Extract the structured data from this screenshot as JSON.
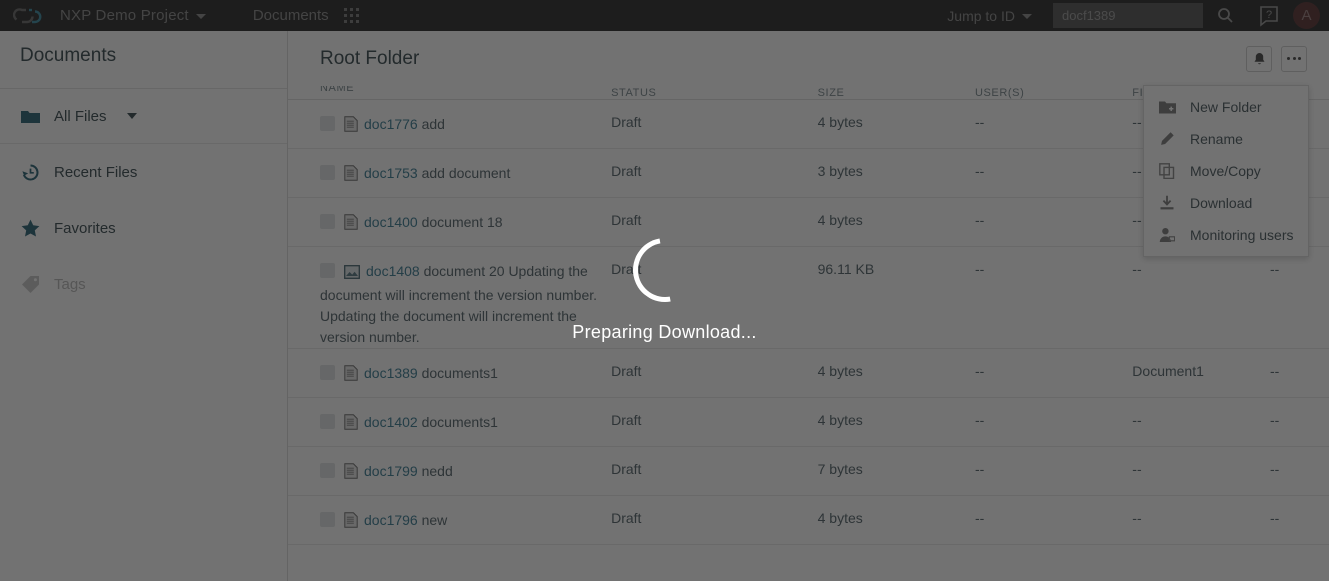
{
  "topbar": {
    "logo_icon": "chain-link-logo-icon",
    "project_name": "NXP Demo Project",
    "project_caret_icon": "chevron-down-icon",
    "nav_documents": "Documents",
    "apps_grid_icon": "apps-grid-icon",
    "jump_to_id_label": "Jump to ID",
    "jump_caret_icon": "chevron-down-icon",
    "search_value": "docf1389",
    "search_placeholder": "",
    "search_icon": "search-icon",
    "help_icon": "help-question-icon",
    "avatar_letter": "A"
  },
  "sidebar": {
    "title": "Documents",
    "items": [
      {
        "label": "All Files",
        "icon": "folder-icon",
        "has_caret": true,
        "dim": false
      },
      {
        "label": "Recent Files",
        "icon": "history-clock-icon",
        "has_caret": false,
        "dim": false
      },
      {
        "label": "Favorites",
        "icon": "star-icon",
        "has_caret": false,
        "dim": false
      },
      {
        "label": "Tags",
        "icon": "tag-icon",
        "has_caret": false,
        "dim": true
      }
    ]
  },
  "content": {
    "folder_title": "Root Folder",
    "bell_icon": "bell-notification-icon",
    "more_icon": "ellipsis-more-icon",
    "columns": [
      "NAME",
      "STATUS",
      "SIZE",
      "USER(S)",
      "FILE CLASS",
      ""
    ],
    "rows": [
      {
        "doc_id": "doc1776",
        "name": " add",
        "icon": "document-file-icon",
        "status": "Draft",
        "size": "4 bytes",
        "users": "--",
        "file_class": "--",
        "last": "--"
      },
      {
        "doc_id": "doc1753",
        "name": " add document",
        "icon": "document-file-icon",
        "status": "Draft",
        "size": "3 bytes",
        "users": "--",
        "file_class": "--",
        "last": "--"
      },
      {
        "doc_id": "doc1400",
        "name": " document 18",
        "icon": "document-file-icon",
        "status": "Draft",
        "size": "4 bytes",
        "users": "--",
        "file_class": "--",
        "last": "--"
      },
      {
        "doc_id": "doc1408",
        "name": " document 20 Updating the document will increment the version number. Updating the document will increment the version number.",
        "icon": "image-file-icon",
        "status": "Draft",
        "size": "96.11 KB",
        "users": "--",
        "file_class": "--",
        "last": "--"
      },
      {
        "doc_id": "doc1389",
        "name": " documents1",
        "icon": "document-file-icon",
        "status": "Draft",
        "size": "4 bytes",
        "users": "--",
        "file_class": "Document1",
        "last": "--"
      },
      {
        "doc_id": "doc1402",
        "name": " documents1",
        "icon": "document-file-icon",
        "status": "Draft",
        "size": "4 bytes",
        "users": "--",
        "file_class": "--",
        "last": "--"
      },
      {
        "doc_id": "doc1799",
        "name": " nedd",
        "icon": "document-file-icon",
        "status": "Draft",
        "size": "7 bytes",
        "users": "--",
        "file_class": "--",
        "last": "--"
      },
      {
        "doc_id": "doc1796",
        "name": " new",
        "icon": "document-file-icon",
        "status": "Draft",
        "size": "4 bytes",
        "users": "--",
        "file_class": "--",
        "last": "--"
      }
    ]
  },
  "context_menu": {
    "items": [
      {
        "label": "New Folder",
        "icon": "new-folder-icon"
      },
      {
        "label": "Rename",
        "icon": "pencil-edit-icon"
      },
      {
        "label": "Move/Copy",
        "icon": "copy-icon"
      },
      {
        "label": "Download",
        "icon": "download-icon"
      },
      {
        "label": "Monitoring users",
        "icon": "user-monitor-icon"
      }
    ]
  },
  "overlay": {
    "spinner_icon": "loading-spinner-icon",
    "message": "Preparing Download..."
  },
  "colors": {
    "topbar_bg": "#2b2b2b",
    "link": "#3c7d95",
    "accent_teal": "#2b6477",
    "avatar_bg": "#5a3434",
    "overlay_scrim": "rgba(20,20,20,0.60)"
  }
}
